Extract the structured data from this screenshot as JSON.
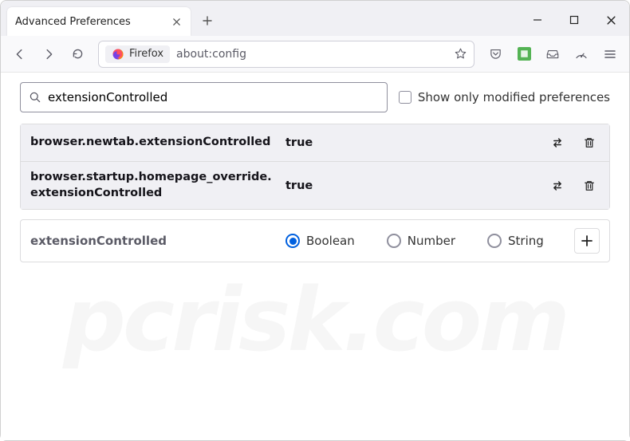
{
  "tab": {
    "title": "Advanced Preferences"
  },
  "urlbar": {
    "pill": "Firefox",
    "url": "about:config"
  },
  "search": {
    "value": "extensionControlled"
  },
  "filter": {
    "show_modified_label": "Show only modified preferences"
  },
  "prefs": [
    {
      "name": "browser.newtab.extensionControlled",
      "value": "true"
    },
    {
      "name": "browser.startup.homepage_override.extensionControlled",
      "value": "true"
    }
  ],
  "newpref": {
    "name": "extensionControlled",
    "types": {
      "boolean": "Boolean",
      "number": "Number",
      "string": "String"
    }
  },
  "watermark": "pcrisk.com"
}
